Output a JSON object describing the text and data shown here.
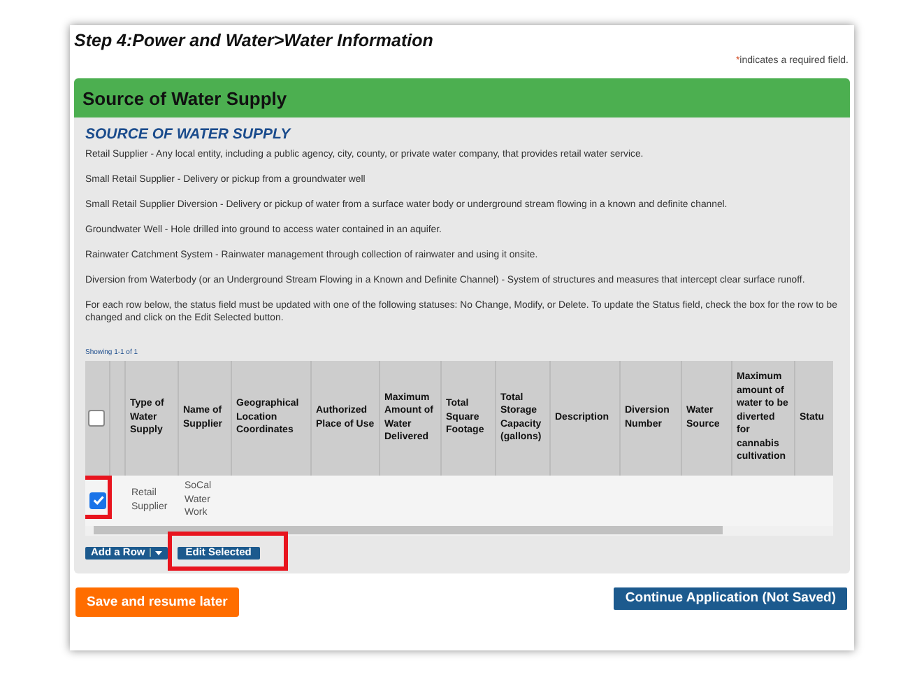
{
  "page_title": "Step 4:Power and Water>Water Information",
  "required_note": {
    "mark": "*",
    "text": "indicates a required field."
  },
  "section": {
    "title": "Source of Water Supply",
    "heading": "SOURCE OF WATER SUPPLY",
    "paragraphs": [
      "Retail Supplier - Any local entity, including a public agency, city, county, or private water company, that provides retail water service.",
      "Small Retail Supplier - Delivery or pickup from a groundwater well",
      "Small Retail Supplier Diversion - Delivery or pickup of water from a surface water body or underground stream flowing in a known and definite channel.",
      "Groundwater Well - Hole drilled into ground to access water contained in an aquifer.",
      "Rainwater Catchment System - Rainwater management through collection of rainwater and using it onsite.",
      "Diversion from Waterbody (or an Underground Stream Flowing in a Known and Definite Channel) - System of structures and measures that intercept clear surface runoff.",
      "For each row below, the status field must be updated with one of the following statuses: No Change, Modify, or Delete. To update the Status field, check the box for the row to be changed and click on the Edit Selected button."
    ]
  },
  "table": {
    "showing": "Showing 1-1 of 1",
    "header_checked": false,
    "columns": [
      "Type of Water Supply",
      "Name of Supplier",
      "Geographical Location Coordinates",
      "Authorized Place of Use",
      "Maximum Amount of Water Delivered",
      "Total Square Footage",
      "Total Storage Capacity (gallons)",
      "Description",
      "Diversion Number",
      "Water Source",
      "Maximum amount of water to be diverted for cannabis cultivation",
      "Statu"
    ],
    "rows": [
      {
        "checked": true,
        "highlighted": true,
        "cells": [
          "Retail Supplier",
          "SoCal Water Work"
        ]
      }
    ]
  },
  "add_row_button": "Add a Row",
  "edit_button": {
    "label": "Edit Selected",
    "highlighted": true
  },
  "save_button": "Save and resume later",
  "continue_button": "Continue Application (Not Saved)"
}
